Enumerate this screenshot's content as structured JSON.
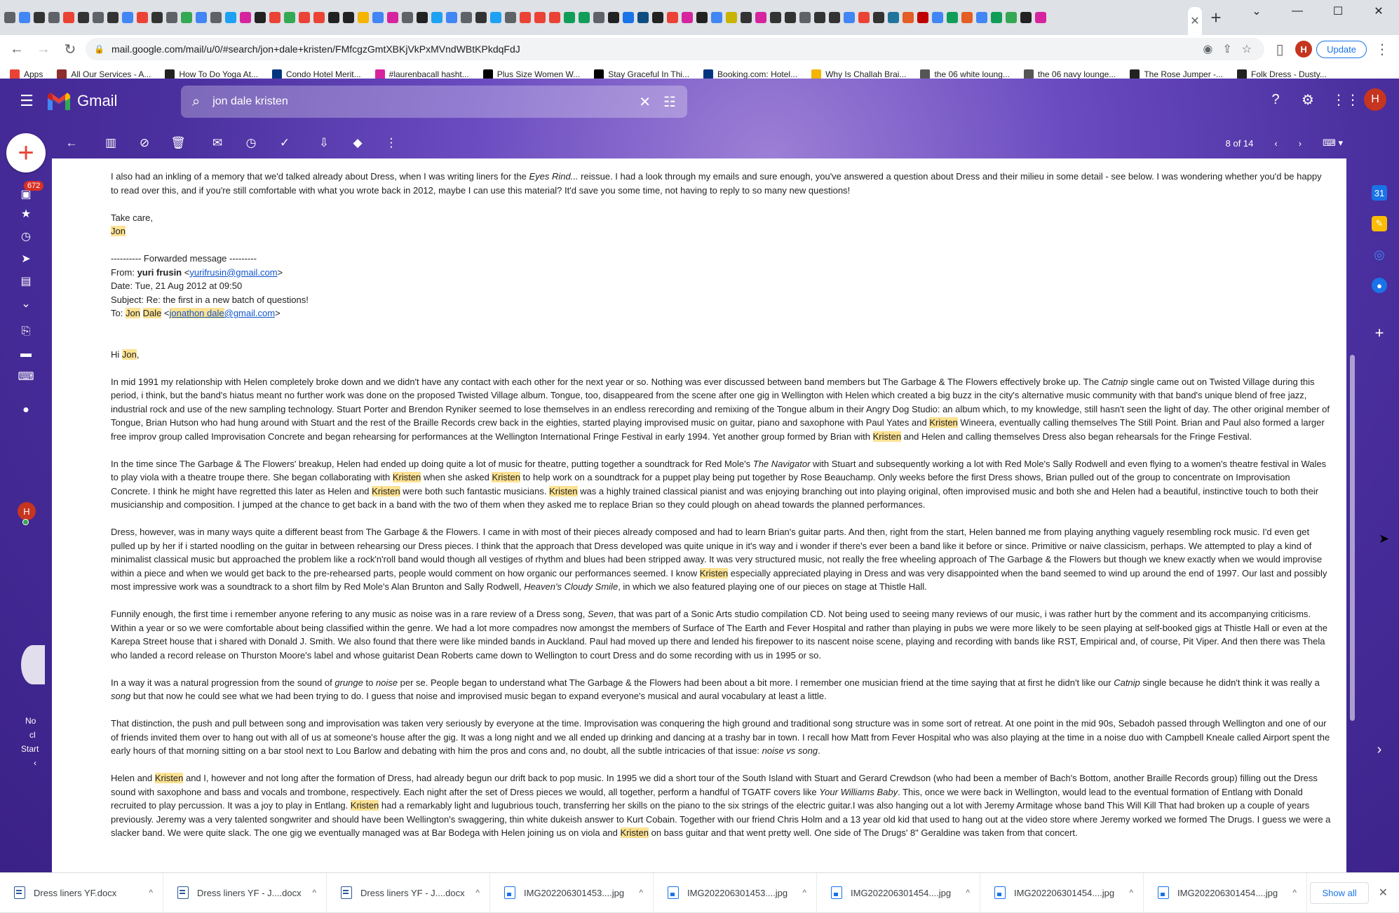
{
  "browser": {
    "tab_close_glyph": "✕",
    "new_tab_glyph": "+",
    "window_controls": [
      "⌄",
      "—",
      "☐",
      "✕"
    ],
    "url": "mail.google.com/mail/u/0/#search/jon+dale+kristen/FMfcgzGmtXBKjVkPxMVndWBtKPkdqFdJ",
    "profile_initial": "H",
    "update_label": "Update",
    "bookmarks": [
      {
        "label": "Apps",
        "color": "#ea4335"
      },
      {
        "label": "All Our Services - A...",
        "color": "#8b2f2f"
      },
      {
        "label": "How To Do Yoga At...",
        "color": "#222222"
      },
      {
        "label": "Condo Hotel Merit...",
        "color": "#003580"
      },
      {
        "label": "#laurenbacall hasht...",
        "color": "#d6249f"
      },
      {
        "label": "Plus Size Women W...",
        "color": "#000000"
      },
      {
        "label": "Stay Graceful In Thi...",
        "color": "#000000"
      },
      {
        "label": "Booking.com: Hotel...",
        "color": "#003580"
      },
      {
        "label": "Why Is Challah Brai...",
        "color": "#f4b400"
      },
      {
        "label": "the 06 white loung...",
        "color": "#555555"
      },
      {
        "label": "the 06 navy lounge...",
        "color": "#555555"
      },
      {
        "label": "The Rose Jumper -...",
        "color": "#222222"
      },
      {
        "label": "Folk Dress - Dusty...",
        "color": "#222222"
      }
    ],
    "favicon_colors": [
      "#5f6368",
      "#4285f4",
      "#333333",
      "#5f6368",
      "#ea4335",
      "#333333",
      "#5f6368",
      "#333333",
      "#4285f4",
      "#ea4335",
      "#333333",
      "#5f6368",
      "#34a853",
      "#4285f4",
      "#5f6368",
      "#1da1f2",
      "#d6249f",
      "#222222",
      "#ea4335",
      "#34a853",
      "#ea4335",
      "#ea4335",
      "#222222",
      "#222222",
      "#f4b400",
      "#4285f4",
      "#d6249f",
      "#5f6368",
      "#222222",
      "#1da1f2",
      "#4285f4",
      "#5f6368",
      "#333333",
      "#1da1f2",
      "#5f6368",
      "#ea4335",
      "#ea4335",
      "#ea4335",
      "#0f9d58",
      "#0f9d58",
      "#5f6368",
      "#222222",
      "#1a73e8",
      "#0f4c81",
      "#222222",
      "#ea4335",
      "#d6249f",
      "#222222",
      "#4285f4",
      "#c8b400",
      "#333333",
      "#d6249f",
      "#333333",
      "#333333",
      "#5f6368",
      "#333333",
      "#333333",
      "#4285f4",
      "#ea4335",
      "#333333",
      "#21759b",
      "#e35d24",
      "#c00000",
      "#4285f4",
      "#0f9d58",
      "#e35d24",
      "#4285f4",
      "#0f9d58",
      "#34a853",
      "#222222",
      "#d6249f"
    ]
  },
  "gmail": {
    "app_name": "Gmail",
    "search_query": "jon dale kristen",
    "unread_count": "672",
    "account_initial": "H",
    "pager": "8 of 14",
    "rail_note": [
      "No",
      "cl",
      "Start",
      "‹"
    ]
  },
  "email": {
    "intro": "I also had an inkling of a memory that we'd talked already about Dress, when I was writing liners for the ",
    "intro_italic": "Eyes Rind...",
    "intro_rest": " reissue. I had a look through my emails and sure enough, you've answered a question about Dress and their milieu in some detail - see below. I was wondering whether you'd be happy to read over this, and if you're still comfortable with what you wrote back in 2012, maybe I can use this material? It'd save you some time, not having to reply to so many new questions!",
    "signoff": "Take care,",
    "signature": "Jon",
    "fwd_header": "---------- Forwarded message ---------",
    "from_label": "From: ",
    "from_name": "yuri frusin",
    "from_email": "yurifrusin@gmail.com",
    "date_line": "Date: Tue, 21 Aug 2012 at 09:50",
    "subject_line": "Subject: Re: the first in a new batch of questions!",
    "to_label": "To: ",
    "to_name_1": "Jon",
    "to_name_2": "Dale",
    "to_email_1": "jonathon",
    "to_email_2": "dale",
    "to_email_3": "@gmail.com",
    "greeting": "Hi ",
    "greeting_name": "Jon",
    "paragraphs": [
      [
        {
          "t": "In mid 1991 my relationship with Helen completely broke down and we didn't have any contact with each other for the next year or so. Nothing was ever discussed between band members but The Garbage & The Flowers effectively broke up. The "
        },
        {
          "t": "Catnip",
          "i": true
        },
        {
          "t": " single came out on Twisted Village during this period, i think, but the band's hiatus meant no further work was done on the proposed Twisted Village album. Tongue, too, disappeared from the scene after one gig in Wellington with Helen which created a big buzz in the city's alternative music community with that band's unique blend of free jazz, industrial rock and use of the new sampling technology. Stuart Porter and Brendon Ryniker seemed to lose themselves in an endless rerecording and remixing of the Tongue album in their Angry Dog Studio: an album which, to my knowledge, still hasn't seen the light of day. The other original member of Tongue, Brian Hutson who had hung around with Stuart and the rest of the Braille Records crew back in the eighties, started playing improvised music on guitar, piano and saxophone with Paul Yates and "
        },
        {
          "t": "Kristen",
          "h": true
        },
        {
          "t": " Wineera, eventually calling themselves The Still Point. Brian and Paul also formed a larger free improv group called Improvisation Concrete and began rehearsing for performances at the Wellington International Fringe Festival in early 1994. Yet another group formed by Brian with "
        },
        {
          "t": "Kristen",
          "h": true
        },
        {
          "t": " and Helen and calling themselves Dress also began rehearsals for the Fringe Festival."
        }
      ],
      [
        {
          "t": "In the time since The Garbage & The Flowers' breakup, Helen had ended up doing quite a lot of music for theatre, putting together a soundtrack for Red Mole's "
        },
        {
          "t": "The Navigator",
          "i": true
        },
        {
          "t": " with Stuart and subsequently working a lot with Red Mole's Sally Rodwell and even flying to a women's theatre festival in Wales to play viola with a theatre troupe there. She began collaborating with "
        },
        {
          "t": "Kristen",
          "h": true
        },
        {
          "t": " when she asked "
        },
        {
          "t": "Kristen",
          "h": true
        },
        {
          "t": " to help work on a soundtrack for a puppet play being put together by Rose Beauchamp. Only weeks before the first Dress shows, Brian pulled out of the group to concentrate on Improvisation Concrete. I think he might have regretted this later as Helen and "
        },
        {
          "t": "Kristen",
          "h": true
        },
        {
          "t": " were both such fantastic musicians. "
        },
        {
          "t": "Kristen",
          "h": true
        },
        {
          "t": " was a highly trained classical pianist and was enjoying branching out into playing original, often improvised music and both she and Helen had a beautiful, instinctive touch to both their musicianship and composition. I jumped at the chance to get back in a band with the two of them when they asked me to replace Brian so they could plough on ahead towards the planned performances."
        }
      ],
      [
        {
          "t": "Dress, however, was in many ways quite a different beast from The Garbage & the Flowers. I came in with most of their pieces already composed and had to learn Brian's guitar parts. And then, right from the start, Helen banned me from playing anything vaguely resembling rock music. I'd even get pulled up by her if i started noodling on the guitar in between rehearsing our Dress pieces. I think that the approach that Dress developed was quite unique in it's way and i wonder if there's ever been a band like it before or since. Primitive or naive classicism, perhaps. We attempted to play a kind of minimalist classical music but approached the problem like a rock'n'roll band would though all vestiges of rhythm and blues had been stripped away. It was very structured music, not really the free wheeling approach of The Garbage & the Flowers but though we knew exactly when we would improvise within a piece and when we would get back to the pre-rehearsed parts, people would comment on how organic our performances seemed. I know "
        },
        {
          "t": "Kristen",
          "h": true
        },
        {
          "t": " especially appreciated playing in Dress and was very disappointed when the band seemed to wind up around the end of 1997. Our last and possibly most impressive work was a soundtrack to a short film by Red Mole's Alan Brunton and Sally Rodwell, "
        },
        {
          "t": "Heaven's Cloudy Smile",
          "i": true
        },
        {
          "t": ", in which we also featured playing one of our pieces on stage at Thistle Hall."
        }
      ],
      [
        {
          "t": "Funnily enough, the first time i remember anyone refering to any music as noise was in a rare review of a Dress song, "
        },
        {
          "t": "Seven",
          "i": true
        },
        {
          "t": ", that was part of a Sonic Arts studio compilation CD. Not being used to seeing many reviews of our music, i was rather hurt by the comment and its accompanying criticisms. Within a year or so we were comfortable about being classified within the genre. We had a lot more compadres now amongst the members of Surface of The Earth and Fever Hospital and rather than playing in pubs we were more likely to be seen playing at self-booked gigs at Thistle Hall or even at the Karepa Street house that i shared with Donald J. Smith. We also found that there were like minded bands in Auckland. Paul had moved up there and lended his firepower to its nascent noise scene, playing and recording with bands like RST, Empirical and, of course, Pit Viper. And then there was Thela who landed a record release on Thurston Moore's label and whose guitarist Dean Roberts came down to Wellington to court Dress and do some recording with us in 1995 or so."
        }
      ],
      [
        {
          "t": "In a way it was a natural progression from the sound of "
        },
        {
          "t": "grunge",
          "i": true
        },
        {
          "t": " to "
        },
        {
          "t": "noise",
          "i": true
        },
        {
          "t": " per se. People began to understand what The Garbage & the Flowers had been about a bit more. I remember one musician friend at the time saying that at first he didn't like our "
        },
        {
          "t": "Catnip",
          "i": true
        },
        {
          "t": " single because he didn't think it was really a "
        },
        {
          "t": "song",
          "i": true
        },
        {
          "t": " but that now he could see what we had been trying to do. I guess that noise and improvised music began to expand everyone's musical and aural vocabulary at least a little."
        }
      ],
      [
        {
          "t": "That distinction, the push and pull between song and improvisation was taken very seriously by everyone at the time. Improvisation was conquering the high ground and traditional song structure was in some sort of retreat. At one point in the mid 90s, Sebadoh passed through Wellington and one of our of friends invited them over to hang out with all of us at someone's house after the gig. It was a long night and we all ended up drinking and dancing at a trashy bar in town. I recall how Matt from Fever Hospital who was also playing at the time in a noise duo with Campbell Kneale called Airport spent the early hours of that morning sitting on a bar stool next to Lou Barlow and debating with him the pros and cons and, no doubt, all the subtle intricacies of that issue: "
        },
        {
          "t": "noise vs song",
          "i": true
        },
        {
          "t": "."
        }
      ],
      [
        {
          "t": "Helen and "
        },
        {
          "t": "Kristen",
          "h": true
        },
        {
          "t": " and I, however and not long after the formation of Dress, had already begun our drift back to pop music. In 1995 we did a short tour of the South Island with Stuart and Gerard Crewdson (who had been a member of Bach's Bottom, another Braille Records group) filling out the Dress sound with saxophone and bass and vocals and trombone, respectively. Each night after the set of Dress pieces we would, all together, perform a handful of TGATF covers like "
        },
        {
          "t": "Your Williams Baby",
          "i": true
        },
        {
          "t": ". This, once we were back in Wellington, would lead to the eventual formation of Entlang with Donald recruited to play percussion. It was a joy to play in Entlang. "
        },
        {
          "t": "Kristen",
          "h": true
        },
        {
          "t": " had a remarkably light and lugubrious touch, transferring her skills on the piano to the six strings of the electric guitar.I was also hanging out a lot with Jeremy Armitage whose band This Will Kill That had broken up a couple of years previously. Jeremy was a very talented songwriter and should have been Wellington's swaggering, thin white dukeish answer to Kurt Cobain. Together with our friend Chris Holm and a 13 year old kid that used to hang out at the video store where Jeremy worked we formed The Drugs. I guess we were a slacker band. We were quite slack. The one gig we eventually managed was at Bar Bodega with Helen joining us on viola and "
        },
        {
          "t": "Kristen",
          "h": true
        },
        {
          "t": " on bass guitar and that went pretty well. One side of The Drugs' 8\" Geraldine was taken from that concert."
        }
      ]
    ]
  },
  "downloads": {
    "items": [
      {
        "name": "Dress liners YF.docx",
        "type": "word"
      },
      {
        "name": "Dress liners YF - J....docx",
        "type": "word"
      },
      {
        "name": "Dress liners YF - J....docx",
        "type": "word"
      },
      {
        "name": "IMG202206301453....jpg",
        "type": "img"
      },
      {
        "name": "IMG202206301453....jpg",
        "type": "img"
      },
      {
        "name": "IMG202206301454....jpg",
        "type": "img"
      },
      {
        "name": "IMG202206301454....jpg",
        "type": "img"
      },
      {
        "name": "IMG202206301454....jpg",
        "type": "img"
      }
    ],
    "show_all_label": "Show all"
  }
}
